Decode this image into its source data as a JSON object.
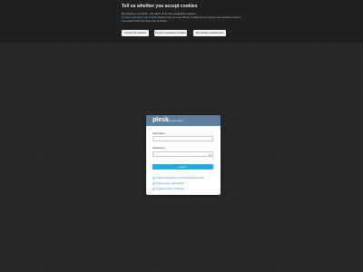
{
  "cookie_banner": {
    "title": "Tell us whether you accept cookies",
    "line1": "By logging in to Plesk, you allow us to use necessary cookies.",
    "line2_link": "Cookie Collection Information",
    "line2_rest": " Select how you use Plesk, it helps us to improve our website content",
    "line3": "you search with the best use of Plesk.",
    "buttons": {
      "accept_all": "Accept all cookies",
      "accept_necessary": "Accept necessary cookies",
      "set_preferences": "Set cookie preferences"
    }
  },
  "login": {
    "brand": "plesk",
    "brand_sub": "web host edition",
    "username_label": "Username",
    "username_value": "",
    "password_label": "Password",
    "password_value": "",
    "login_button": "Log in",
    "links": {
      "forgot_both": "Forgot username and password (in use)",
      "forgot_password": "Forgot your password?",
      "cookie_policy": "Cookies policy in Plesk"
    }
  },
  "colors": {
    "header_blue": "#5d7f9d",
    "button_blue": "#2aa7dd",
    "link_blue": "#2a8cc3"
  }
}
